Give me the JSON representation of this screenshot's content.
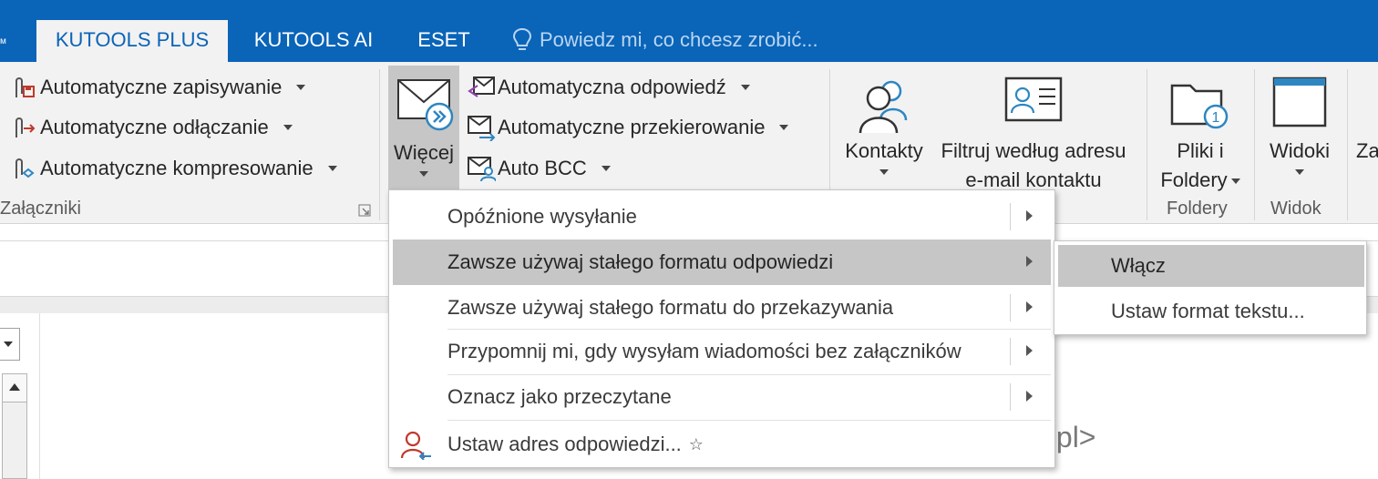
{
  "tabs": [
    {
      "label": "KUTOOLS PLUS",
      "active": true
    },
    {
      "label": "KUTOOLS AI",
      "active": false
    },
    {
      "label": "ESET",
      "active": false
    }
  ],
  "tell_me": {
    "placeholder": "Powiedz mi, co chcesz zrobić...",
    "icon": "lightbulb-icon"
  },
  "title_edge": "м",
  "ribbon": {
    "attachments": {
      "group_label": "Załączniki",
      "items": [
        {
          "label": "Automatyczne zapisywanie",
          "icon": "paperclip-save-icon"
        },
        {
          "label": "Automatyczne odłączanie",
          "icon": "paperclip-detach-icon"
        },
        {
          "label": "Automatyczne kompresowanie",
          "icon": "paperclip-compress-icon"
        }
      ]
    },
    "more": {
      "label": "Więcej",
      "icon": "envelope-forward-icon"
    },
    "mail_items": [
      {
        "label": "Automatyczna odpowiedź",
        "icon": "envelope-reply-icon"
      },
      {
        "label": "Automatyczne przekierowanie",
        "icon": "envelope-redirect-icon"
      },
      {
        "label": "Auto BCC",
        "icon": "envelope-bcc-icon"
      }
    ],
    "contacts": {
      "label": "Kontakty",
      "icon": "contacts-icon"
    },
    "filter": {
      "line1": "Filtruj według adresu",
      "line2": "e-mail kontaktu",
      "icon": "contact-card-icon"
    },
    "files": {
      "line1": "Pliki i",
      "line2": "Foldery",
      "group_label": "Foldery",
      "icon": "folder-icon"
    },
    "views": {
      "label": "Widoki",
      "group_label": "Widok",
      "icon": "window-icon"
    },
    "cut_label": "Za"
  },
  "menu": {
    "items": [
      {
        "label": "Opóźnione wysyłanie",
        "submenu": true,
        "highlighted": false
      },
      {
        "label": "Zawsze używaj stałego formatu odpowiedzi",
        "submenu": true,
        "highlighted": true
      },
      {
        "label": "Zawsze używaj stałego formatu do przekazywania",
        "submenu": true,
        "highlighted": false
      },
      {
        "label": "Przypomnij mi, gdy wysyłam wiadomości bez załączników",
        "submenu": true,
        "highlighted": false
      },
      {
        "label": "Oznacz jako przeczytane",
        "submenu": true,
        "highlighted": false
      },
      {
        "label": "Ustaw adres odpowiedzi...",
        "submenu": false,
        "highlighted": false,
        "icon": "reply-address-icon",
        "star": "☆"
      }
    ]
  },
  "submenu": {
    "items": [
      {
        "label": "Włącz",
        "highlighted": true
      },
      {
        "label": "Ustaw format tekstu...",
        "highlighted": false
      }
    ]
  },
  "email_tail": ".pl>"
}
